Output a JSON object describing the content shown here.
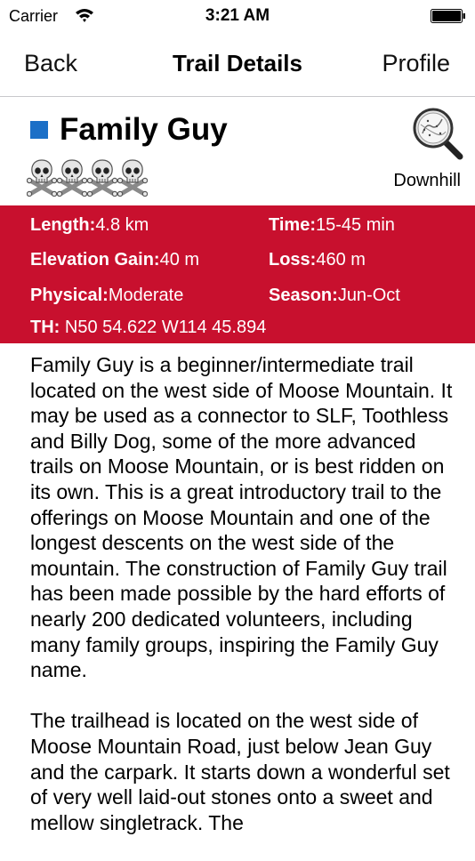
{
  "status_bar": {
    "carrier": "Carrier",
    "time": "3:21 AM"
  },
  "nav": {
    "back_label": "Back",
    "title": "Trail Details",
    "profile_label": "Profile"
  },
  "trail": {
    "name": "Family Guy",
    "color": "#1b6fc7",
    "difficulty_icon": "skull-and-crossbones-icon",
    "difficulty_count": 4,
    "type": "Downhill",
    "map_icon": "magnifier-map-icon"
  },
  "stats": {
    "background_color": "#c8102e",
    "length_label": "Length:",
    "length_value": "4.8 km",
    "time_label": "Time:",
    "time_value": "15-45 min",
    "elevation_label": "Elevation Gain:",
    "elevation_value": "40 m",
    "loss_label": "Loss:",
    "loss_value": "460 m",
    "physical_label": "Physical:",
    "physical_value": "Moderate",
    "season_label": "Season:",
    "season_value": "Jun-Oct",
    "th_label": "TH:",
    "th_value": "N50 54.622 W114 45.894"
  },
  "description": {
    "p1": "Family Guy is a beginner/intermediate trail located on the west side of Moose Mountain. It may be used as a connector to SLF, Toothless and Billy Dog, some of the more advanced trails on Moose Mountain, or is best ridden on its own. This is a great introductory trail to the offerings on Moose Mountain and one of the longest descents on the west side of the mountain. The construction of Family Guy trail has been made possible by the hard efforts of nearly 200 dedicated volunteers, including many family groups, inspiring the Family Guy name.",
    "p2": "The trailhead is located on the west side of Moose Mountain Road, just below Jean Guy and the carpark. It starts down a wonderful set of very well laid-out stones onto a sweet and mellow singletrack. The"
  }
}
